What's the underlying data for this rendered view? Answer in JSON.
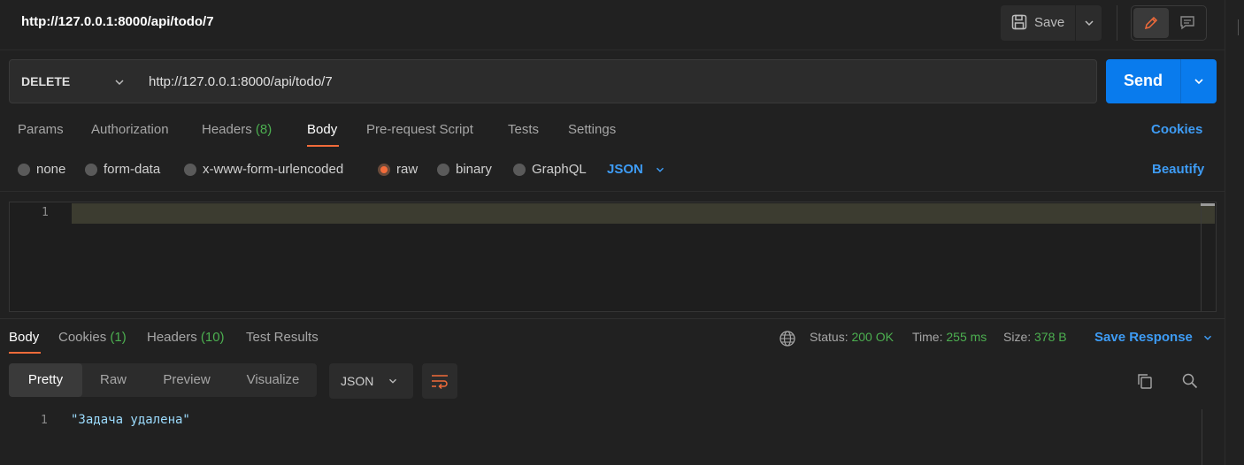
{
  "header": {
    "title": "http://127.0.0.1:8000/api/todo/7",
    "save_label": "Save"
  },
  "request": {
    "method": "DELETE",
    "url": "http://127.0.0.1:8000/api/todo/7",
    "send_label": "Send"
  },
  "request_tabs": {
    "params": "Params",
    "authorization": "Authorization",
    "headers": "Headers",
    "headers_count": "(8)",
    "body": "Body",
    "prerequest": "Pre-request Script",
    "tests": "Tests",
    "settings": "Settings",
    "active": "Body"
  },
  "cookies_link": "Cookies",
  "body_types": {
    "none": "none",
    "form_data": "form-data",
    "urlencoded": "x-www-form-urlencoded",
    "raw": "raw",
    "binary": "binary",
    "graphql": "GraphQL",
    "selected": "raw",
    "language": "JSON"
  },
  "beautify_link": "Beautify",
  "editor": {
    "line_number": "1",
    "content": ""
  },
  "response_tabs": {
    "body": "Body",
    "cookies": "Cookies",
    "cookies_count": "(1)",
    "headers": "Headers",
    "headers_count": "(10)",
    "test_results": "Test Results",
    "active": "Body"
  },
  "response_meta": {
    "status_label": "Status:",
    "status_value": "200 OK",
    "time_label": "Time:",
    "time_value": "255 ms",
    "size_label": "Size:",
    "size_value": "378 B",
    "save_response": "Save Response"
  },
  "response_views": {
    "pretty": "Pretty",
    "raw": "Raw",
    "preview": "Preview",
    "visualize": "Visualize",
    "active": "Pretty",
    "format": "JSON"
  },
  "response_body": {
    "line_number": "1",
    "text": "\"Задача удалена\""
  },
  "colors": {
    "accent_orange": "#f26b3a",
    "link_blue": "#3e9cf5",
    "send_blue": "#097bed",
    "success_green": "#4caf50",
    "background": "#212121"
  },
  "icons": [
    "save-icon",
    "chevron-down-icon",
    "pencil-icon",
    "comment-icon",
    "globe-icon",
    "wrap-lines-icon",
    "copy-icon",
    "search-icon"
  ]
}
